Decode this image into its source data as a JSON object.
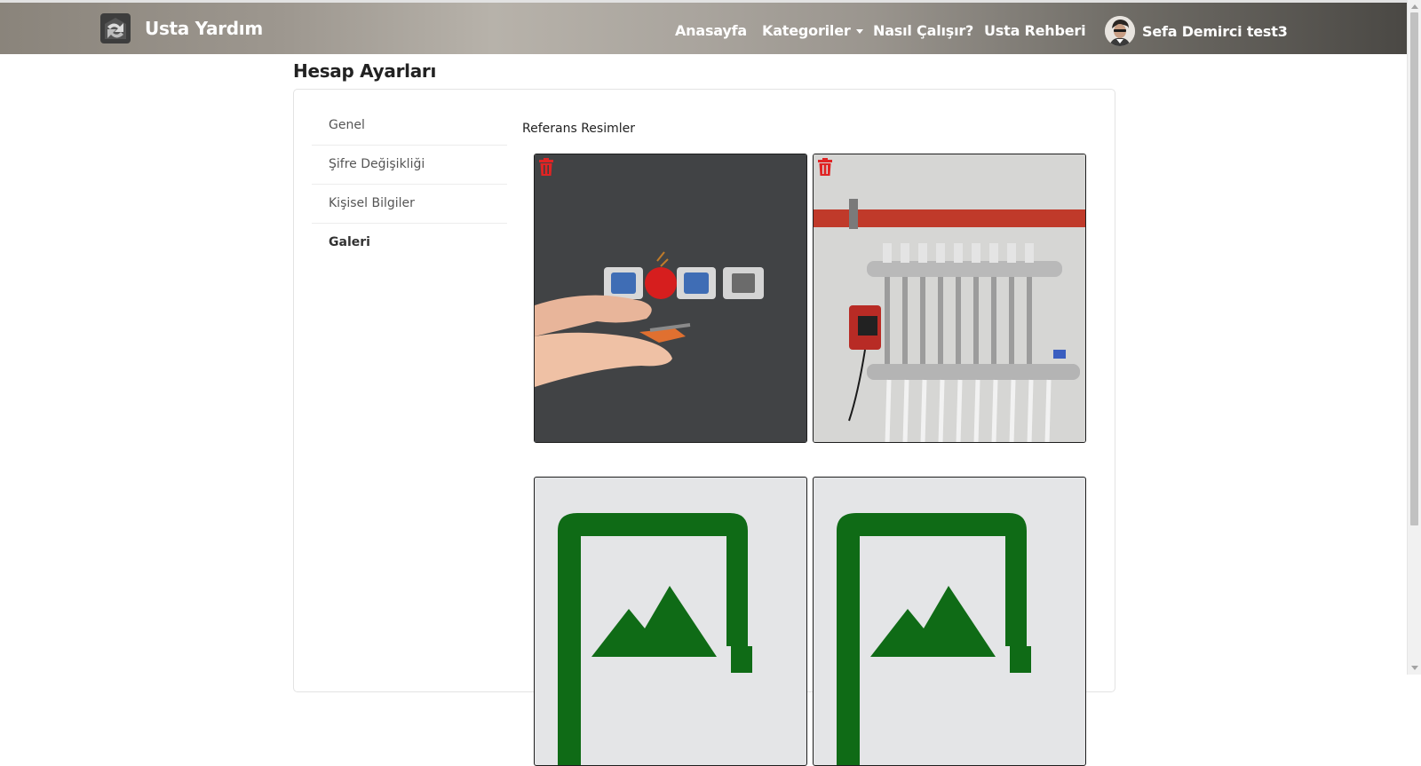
{
  "navbar": {
    "brand_name": "Usta Yardım",
    "links": {
      "home": "Anasayfa",
      "categories": "Kategoriler",
      "how_it_works": "Nasıl Çalışır?",
      "guide": "Usta Rehberi"
    },
    "user_name": "Sefa Demirci test3"
  },
  "page": {
    "title": "Hesap Ayarları"
  },
  "side_menu": {
    "items": [
      {
        "label": "Genel"
      },
      {
        "label": "Şifre Değişikliği"
      },
      {
        "label": "Kişisel Bilgiler"
      },
      {
        "label": "Galeri",
        "active": true
      }
    ]
  },
  "gallery": {
    "section_title": "Referans Resimler",
    "images": [
      {
        "icon": "electric-socket-photo",
        "deletable": true
      },
      {
        "icon": "plumbing-manifold-photo",
        "deletable": true
      },
      {
        "icon": "image-placeholder-icon",
        "deletable": false
      },
      {
        "icon": "image-placeholder-icon",
        "deletable": false
      }
    ]
  },
  "colors": {
    "delete_icon": "#e02424",
    "placeholder_green": "#0f6b16",
    "placeholder_bg": "#e4e5e7"
  }
}
